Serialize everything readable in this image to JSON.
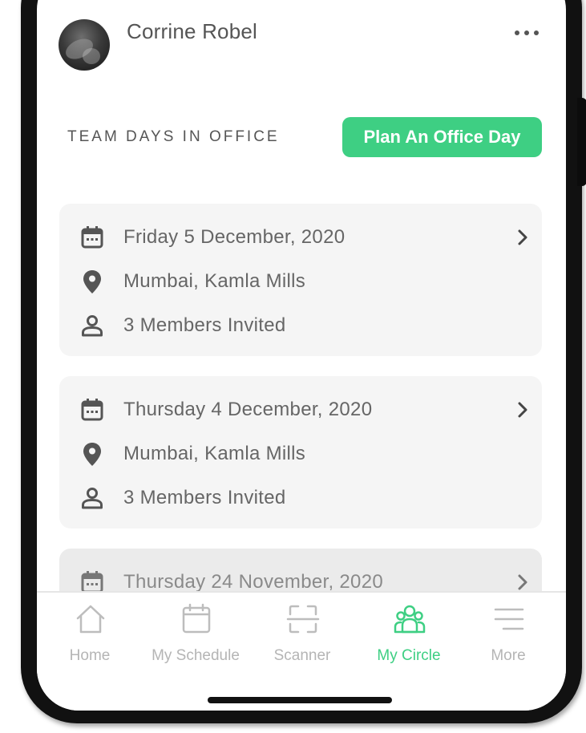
{
  "header": {
    "user_name": "Corrine Robel",
    "more_icon": "more-horizontal-icon"
  },
  "section": {
    "title": "TEAM DAYS IN OFFICE",
    "plan_button_label": "Plan An Office Day"
  },
  "office_days": [
    {
      "date": "Friday 5 December, 2020",
      "location": "Mumbai, Kamla Mills",
      "members": "3 Members Invited"
    },
    {
      "date": "Thursday 4 December, 2020",
      "location": "Mumbai, Kamla Mills",
      "members": "3 Members Invited"
    },
    {
      "date": "Thursday 24 November, 2020"
    }
  ],
  "bottom_nav": {
    "items": [
      {
        "label": "Home",
        "icon": "home-icon",
        "active": false
      },
      {
        "label": "My Schedule",
        "icon": "calendar-icon",
        "active": false
      },
      {
        "label": "Scanner",
        "icon": "scanner-icon",
        "active": false
      },
      {
        "label": "My Circle",
        "icon": "group-icon",
        "active": true
      },
      {
        "label": "More",
        "icon": "menu-icon",
        "active": false
      }
    ]
  },
  "colors": {
    "accent": "#3ecf83",
    "text_primary": "#555555",
    "card_background": "#f5f5f5",
    "nav_inactive": "#b5b5b5"
  }
}
